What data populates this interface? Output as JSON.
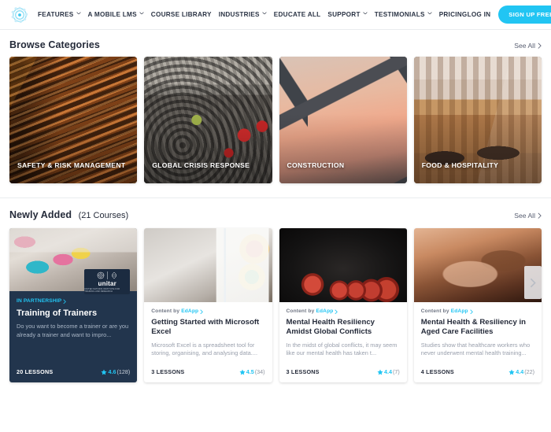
{
  "nav": {
    "logo_icon": "flower-logo-icon",
    "items": [
      {
        "label": "FEATURES",
        "has_caret": true
      },
      {
        "label": "A MOBILE LMS",
        "has_caret": true
      },
      {
        "label": "COURSE LIBRARY",
        "has_caret": false
      },
      {
        "label": "INDUSTRIES",
        "has_caret": true
      },
      {
        "label": "EDUCATE ALL",
        "has_caret": false
      },
      {
        "label": "SUPPORT",
        "has_caret": true
      },
      {
        "label": "TESTIMONIALS",
        "has_caret": true
      },
      {
        "label": "PRICING",
        "has_caret": false
      }
    ],
    "login_label": "LOG IN",
    "signup_label": "SIGN UP FREE",
    "accent_color": "#21c5f3"
  },
  "browse_categories": {
    "title": "Browse Categories",
    "see_all_label": "See All",
    "cards": [
      {
        "label": "SAFETY & RISK MANAGEMENT",
        "image_name": "stairs-photo"
      },
      {
        "label": "GLOBAL CRISIS RESPONSE",
        "image_name": "protest-crowd-photo"
      },
      {
        "label": "CONSTRUCTION",
        "image_name": "crane-sunset-photo"
      },
      {
        "label": "FOOD & HOSPITALITY",
        "image_name": "cafe-counter-photo"
      }
    ]
  },
  "newly_added": {
    "title": "Newly Added",
    "count_label": "(21 Courses)",
    "see_all_label": "See All",
    "next_arrow_icon": "chevron-right-icon",
    "courses": [
      {
        "variant": "partner",
        "image_name": "workshop-sticky-notes-photo",
        "eyebrow": "IN PARTNERSHIP",
        "partner_badge": {
          "name": "unitar",
          "sub": "UNITED NATIONS INSTITUTE FOR TRAINING AND RESEARCH"
        },
        "title": "Training of Trainers",
        "description": "Do you want to become a trainer or are you already a trainer and want to impro...",
        "lessons": "20 LESSONS",
        "rating": "4.6",
        "reviews": "(128)"
      },
      {
        "variant": "standard",
        "image_name": "laptop-charts-photo",
        "eyebrow": "Content by",
        "brand": "EdApp",
        "title": "Getting Started with Microsoft Excel",
        "description": "Microsoft Excel is a spreadsheet tool for storing, organising, and analysing data....",
        "lessons": "3 LESSONS",
        "rating": "4.5",
        "reviews": "(34)"
      },
      {
        "variant": "standard",
        "image_name": "newtons-cradle-photo",
        "eyebrow": "Content by",
        "brand": "EdApp",
        "title": "Mental Health Resiliency Amidst Global Conflicts",
        "description": "In the midst of global conflicts, it may seem like our mental health has taken t...",
        "lessons": "3 LESSONS",
        "rating": "4.4",
        "reviews": "(7)"
      },
      {
        "variant": "standard",
        "image_name": "stacked-hands-photo",
        "eyebrow": "Content by",
        "brand": "EdApp",
        "title": "Mental Health & Resiliency in Aged Care Facilities",
        "description": "Studies show that healthcare workers who never underwent mental health training...",
        "lessons": "4 LESSONS",
        "rating": "4.4",
        "reviews": "(22)"
      }
    ]
  }
}
